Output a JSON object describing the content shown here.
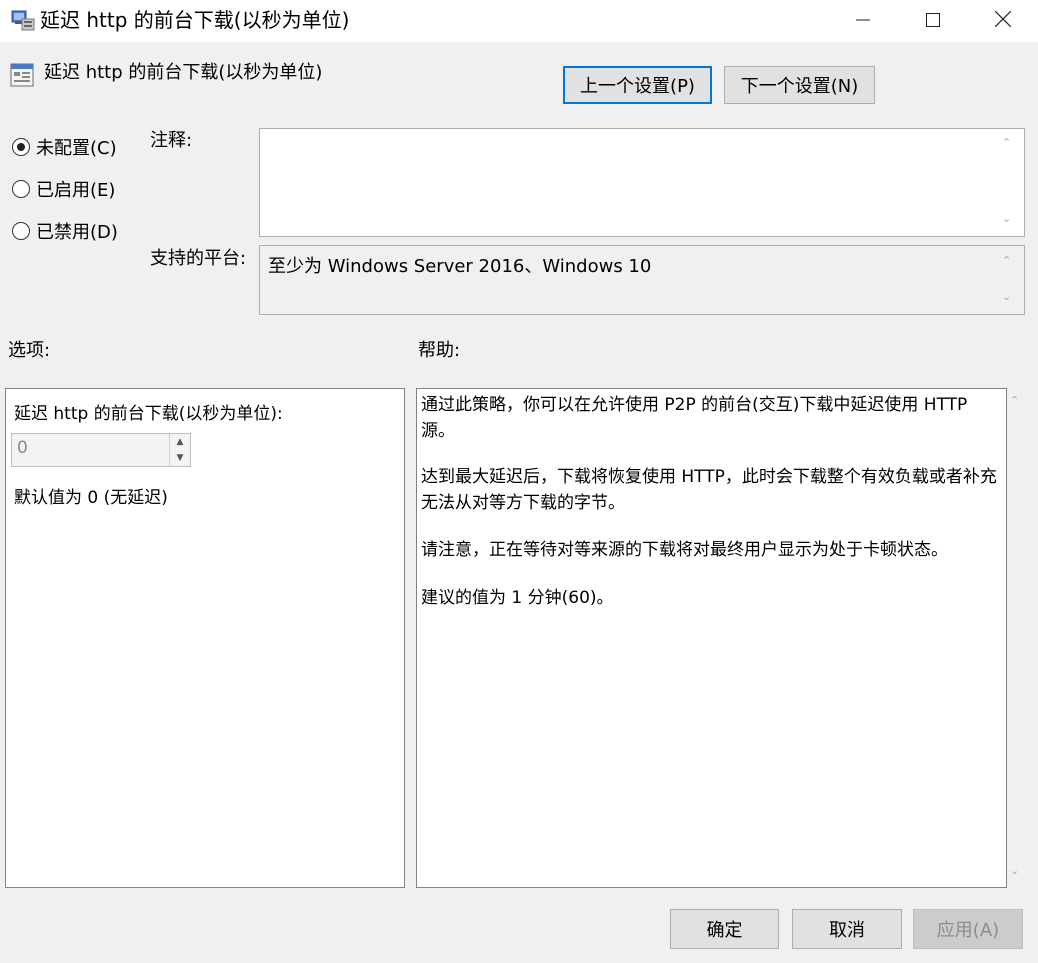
{
  "window": {
    "title": "延迟 http 的前台下载(以秒为单位)"
  },
  "header": {
    "policy_title": "延迟 http 的前台下载(以秒为单位)",
    "prev_button": "上一个设置(P)",
    "next_button": "下一个设置(N)"
  },
  "state": {
    "options": [
      {
        "label": "未配置(C)",
        "checked": true
      },
      {
        "label": "已启用(E)",
        "checked": false
      },
      {
        "label": "已禁用(D)",
        "checked": false
      }
    ]
  },
  "comment": {
    "label": "注释:",
    "value": ""
  },
  "platform": {
    "label": "支持的平台:",
    "value": "至少为 Windows Server 2016、Windows 10"
  },
  "options_section": {
    "label": "选项:",
    "option_label": "延迟 http 的前台下载(以秒为单位):",
    "spinner_value": "0",
    "default_text": "默认值为 0 (无延迟)"
  },
  "help_section": {
    "label": "帮助:",
    "paragraphs": [
      "通过此策略，你可以在允许使用 P2P 的前台(交互)下载中延迟使用 HTTP 源。",
      "达到最大延迟后，下载将恢复使用 HTTP，此时会下载整个有效负载或者补充无法从对等方下载的字节。",
      "请注意，正在等待对等来源的下载将对最终用户显示为处于卡顿状态。",
      "建议的值为 1 分钟(60)。"
    ]
  },
  "footer": {
    "ok_button": "确定",
    "cancel_button": "取消",
    "apply_button": "应用(A)"
  },
  "colors": {
    "window_bg": "#f0f0f0",
    "focus_border": "#0078d7",
    "disabled_text": "#8d8d8d"
  }
}
